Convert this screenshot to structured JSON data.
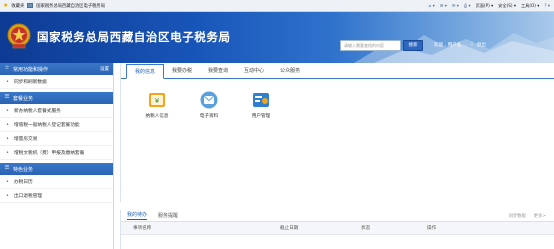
{
  "browser": {
    "favorites_label": "收藏夹",
    "tab_title": "国家税务总局西藏自治区电子税务局",
    "menu": [
      "页面(P) ▾",
      "安全(S) ▾",
      "工具(O) ▾"
    ]
  },
  "header": {
    "title": "国家税务总局西藏自治区电子税务局",
    "search_placeholder": "请输入需要查找的内容",
    "search_button": "搜索",
    "user_text": "欢迎 , 用户名 ...",
    "logout": "退出"
  },
  "sidebar": {
    "sections": [
      {
        "title": "常用功能和操作",
        "action": "设置",
        "icon": "star-icon",
        "items": [
          "同步和刷新数据"
        ]
      },
      {
        "title": "套餐业务",
        "icon": "list-icon",
        "items": [
          "新办纳税人套餐式服务",
          "增值税一般纳税人登记套餐功能",
          "增量房交易",
          "增税文税机（费）申报及缴纳套餐"
        ]
      },
      {
        "title": "特色业务",
        "icon": "list-icon",
        "items": [
          "办税日历",
          "出口退税管理"
        ]
      }
    ]
  },
  "main": {
    "tabs": [
      "我的信息",
      "我要办税",
      "我要查询",
      "互动中心",
      "公众服务"
    ],
    "active_tab": 0,
    "apps": [
      {
        "label": "纳税人信息",
        "icon": "taxpayer-info-icon"
      },
      {
        "label": "电子资料",
        "icon": "electronic-docs-icon"
      },
      {
        "label": "用户管理",
        "icon": "user-management-icon"
      }
    ]
  },
  "bottom": {
    "tabs": [
      "我的待办",
      "服务提醒"
    ],
    "right_links": [
      "同步数据",
      "更多>"
    ],
    "columns": [
      "事项名称",
      "截止日期",
      "状态",
      "操作"
    ]
  },
  "colors": {
    "header_dark": "#0d3a93",
    "accent": "#3a77c9"
  }
}
